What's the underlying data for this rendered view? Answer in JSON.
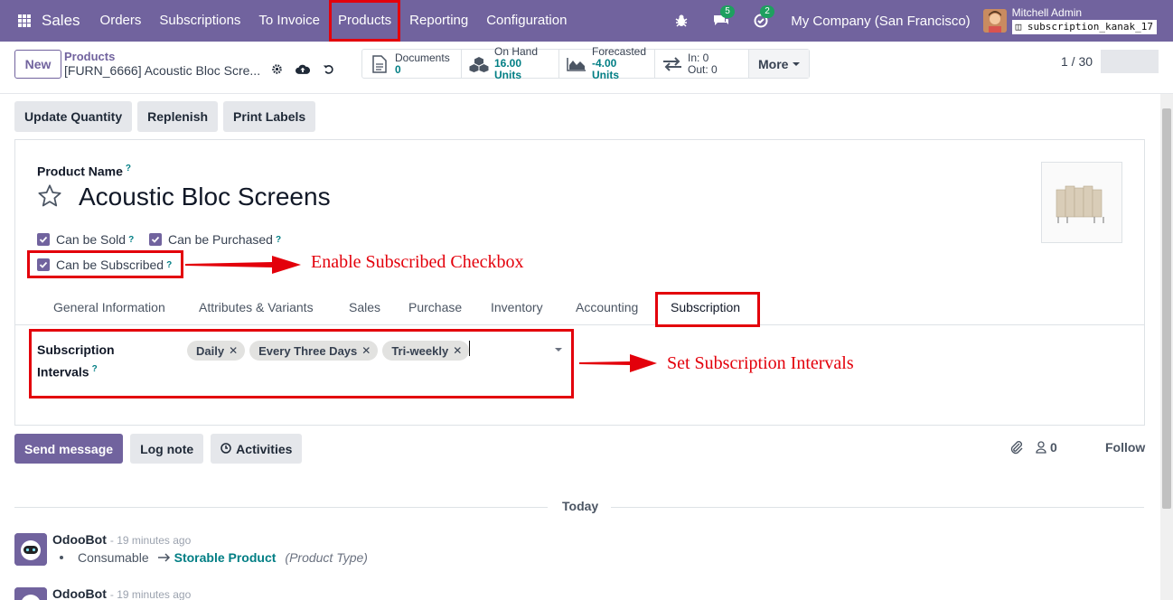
{
  "navbar": {
    "brand": "Sales",
    "menu": [
      "Orders",
      "Subscriptions",
      "To Invoice",
      "Products",
      "Reporting",
      "Configuration"
    ],
    "messages_badge": "5",
    "activities_badge": "2",
    "company": "My Company (San Francisco)",
    "user_name": "Mitchell Admin",
    "database": "subscription_kanak_17",
    "icons": [
      "apps-grid-icon",
      "bug-icon",
      "chat-bubbles-icon",
      "clock-check-icon"
    ]
  },
  "control_panel": {
    "new_label": "New",
    "breadcrumb_parent": "Products",
    "breadcrumb_current": "[FURN_6666] Acoustic Bloc Scre...",
    "stats": [
      {
        "label": "Documents",
        "value": "0",
        "icon": "document-icon"
      },
      {
        "label": "On Hand",
        "value": "16.00 Units",
        "icon": "cubes-icon"
      },
      {
        "label": "Forecasted",
        "value": "-4.00 Units",
        "icon": "area-chart-icon"
      },
      {
        "label": "In: 0",
        "value": "Out: 0",
        "icon": "exchange-arrows-icon"
      }
    ],
    "more_label": "More",
    "pager": "1 / 30"
  },
  "actions": [
    "Update Quantity",
    "Replenish",
    "Print Labels"
  ],
  "form": {
    "product_name_label": "Product Name",
    "product_name": "Acoustic Bloc Screens",
    "tooltip_mark": "?",
    "checkboxes": [
      "Can be Sold",
      "Can be Purchased",
      "Can be Subscribed"
    ],
    "tabs": [
      "General Information",
      "Attributes & Variants",
      "Sales",
      "Purchase",
      "Inventory",
      "Accounting",
      "Subscription"
    ],
    "active_tab": "Subscription",
    "subscription_intervals_label_1": "Subscription",
    "subscription_intervals_label_2": "Intervals",
    "intervals": [
      "Daily",
      "Every Three Days",
      "Tri-weekly"
    ]
  },
  "annotations": {
    "checkbox_note": "Enable Subscribed Checkbox",
    "intervals_note": "Set Subscription Intervals",
    "color": "#e3000b"
  },
  "chatter": {
    "send_message": "Send message",
    "log_note": "Log note",
    "activities": "Activities",
    "followers_count": "0",
    "follow": "Follow",
    "today": "Today",
    "messages": [
      {
        "author": "OdooBot",
        "time": "- 19 minutes ago",
        "old": "Consumable",
        "new": "Storable Product",
        "field": "(Product Type)"
      },
      {
        "author": "OdooBot",
        "time": "- 19 minutes ago"
      }
    ]
  },
  "colors": {
    "primary": "#71639e",
    "accent": "#017e84",
    "badge": "#1ea05f"
  }
}
